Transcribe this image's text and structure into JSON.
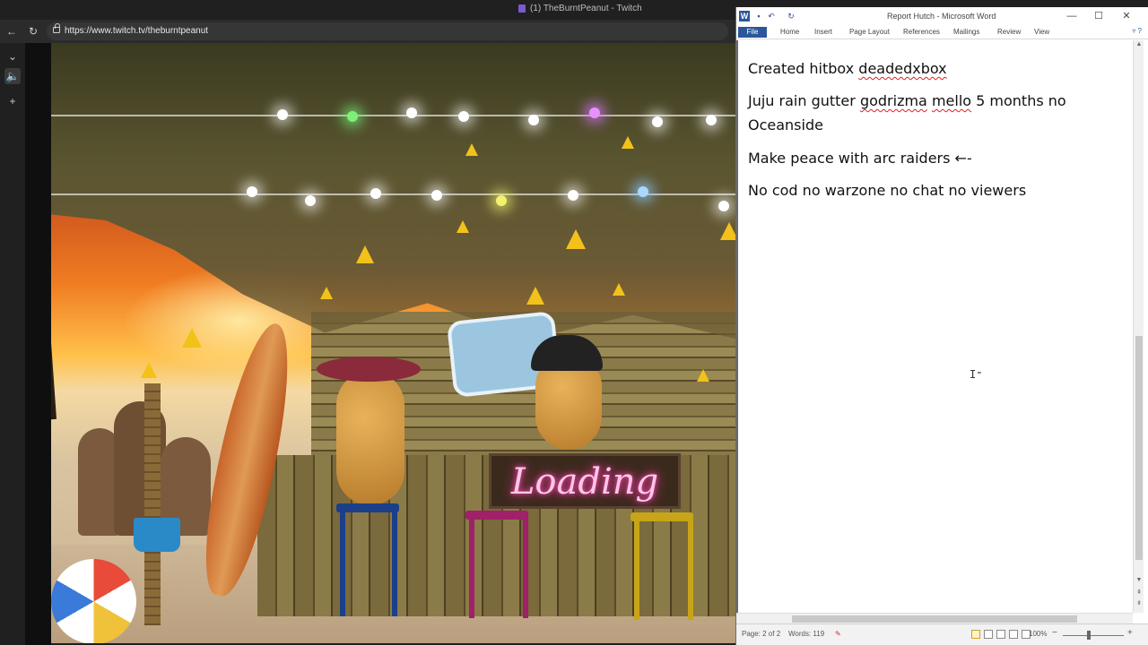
{
  "browser": {
    "tab_title": "(1) TheBurntPeanut - Twitch",
    "url": "https://www.twitch.tv/theburntpeanut",
    "back_glyph": "←",
    "refresh_glyph": "↻",
    "side_chevron": "⌄",
    "side_audio": "🔈",
    "side_add": "+"
  },
  "stream": {
    "overlay_text": "Loading"
  },
  "word": {
    "title": "Report Hutch  -  Microsoft Word",
    "logo": "W",
    "window_controls": {
      "minimize": "—",
      "maximize": "☐",
      "close": "✕"
    },
    "ribbon_tabs": [
      "File",
      "Home",
      "Insert",
      "Page Layout",
      "References",
      "Mailings",
      "Review",
      "View"
    ],
    "ribbon_right": "▿ ?",
    "paragraphs": [
      {
        "pre": "Created hitbox ",
        "spell": "deadedxbox",
        "post": ""
      },
      {
        "pre": "Juju rain gutter ",
        "spell": "godrizma",
        "mid": " ",
        "spell2": "mello",
        "post": " 5 months no Oceanside"
      },
      {
        "pre": "Make peace with arc raiders ←-",
        "spell": "",
        "post": ""
      },
      {
        "pre": "No cod no warzone no chat no viewers",
        "spell": "",
        "post": ""
      }
    ],
    "status": {
      "page": "Page: 2 of 2",
      "words": "Words: 119",
      "zoom": "100%",
      "zoom_minus": "−",
      "zoom_plus": "+"
    },
    "cursor_glyph": "I⁼"
  }
}
